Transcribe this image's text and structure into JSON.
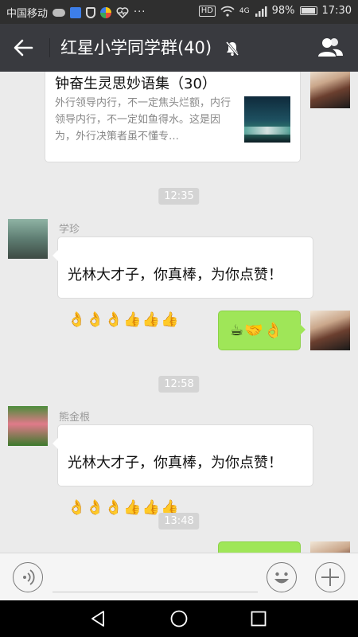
{
  "status_bar": {
    "carrier": "中国移动",
    "dots": "···",
    "hd": "HD",
    "signal": "4G",
    "battery": "98%",
    "time": "17:30"
  },
  "header": {
    "title": "红星小学同学群(40)"
  },
  "messages": {
    "card": {
      "title": "钟奋生灵思妙语集（30）",
      "desc": "外行领导内行，不一定焦头烂额，内行领导内行，不一定如鱼得水。这是因为，外行决策者虽不懂专…"
    },
    "ts1": "12:35",
    "m1": {
      "sender": "学珍",
      "text": "光林大才子，你真棒，为你点赞！",
      "emojis": "👌👌👌👍👍👍"
    },
    "m2": {
      "emojis": "☕🤝👌"
    },
    "ts2": "12:58",
    "m3": {
      "sender": "熊金根",
      "text": "光林大才子，你真棒，为你点赞！",
      "emojis": "👌👌👌👍👍👍"
    },
    "ts3": "13:48"
  },
  "colors": {
    "header_bg": "#393a3f",
    "chat_bg": "#ebebeb",
    "self_bubble": "#9fe658",
    "timestamp_bg": "#d4d4d4"
  }
}
